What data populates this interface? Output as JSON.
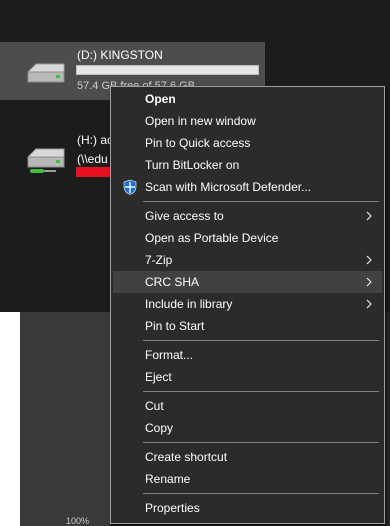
{
  "drives": {
    "d": {
      "name": "(D:) KINGSTON",
      "size_text": "57.4 GB free of 57.6 GB",
      "used_fraction": 0.0
    },
    "h": {
      "name": "(H:) ac",
      "path": "(\\\\edu",
      "used_fraction": 1.0
    }
  },
  "status_bar": {
    "zoom": "100%"
  },
  "context_menu": {
    "groups": [
      [
        {
          "label": "Open",
          "bold": true
        },
        {
          "label": "Open in new window"
        },
        {
          "label": "Pin to Quick access"
        },
        {
          "label": "Turn BitLocker on"
        },
        {
          "label": "Scan with Microsoft Defender...",
          "icon": "defender-shield-icon"
        }
      ],
      [
        {
          "label": "Give access to",
          "submenu": true
        },
        {
          "label": "Open as Portable Device"
        },
        {
          "label": "7-Zip",
          "submenu": true
        },
        {
          "label": "CRC SHA",
          "submenu": true,
          "highlighted": true
        },
        {
          "label": "Include in library",
          "submenu": true
        },
        {
          "label": "Pin to Start"
        }
      ],
      [
        {
          "label": "Format..."
        },
        {
          "label": "Eject"
        }
      ],
      [
        {
          "label": "Cut"
        },
        {
          "label": "Copy"
        }
      ],
      [
        {
          "label": "Create shortcut"
        },
        {
          "label": "Rename"
        }
      ],
      [
        {
          "label": "Properties"
        }
      ]
    ]
  },
  "colors": {
    "background": "#191919",
    "menu_background": "#2b2b2b",
    "menu_highlight": "#414141",
    "usage_low": "#26a0da",
    "usage_full": "#e81123"
  }
}
